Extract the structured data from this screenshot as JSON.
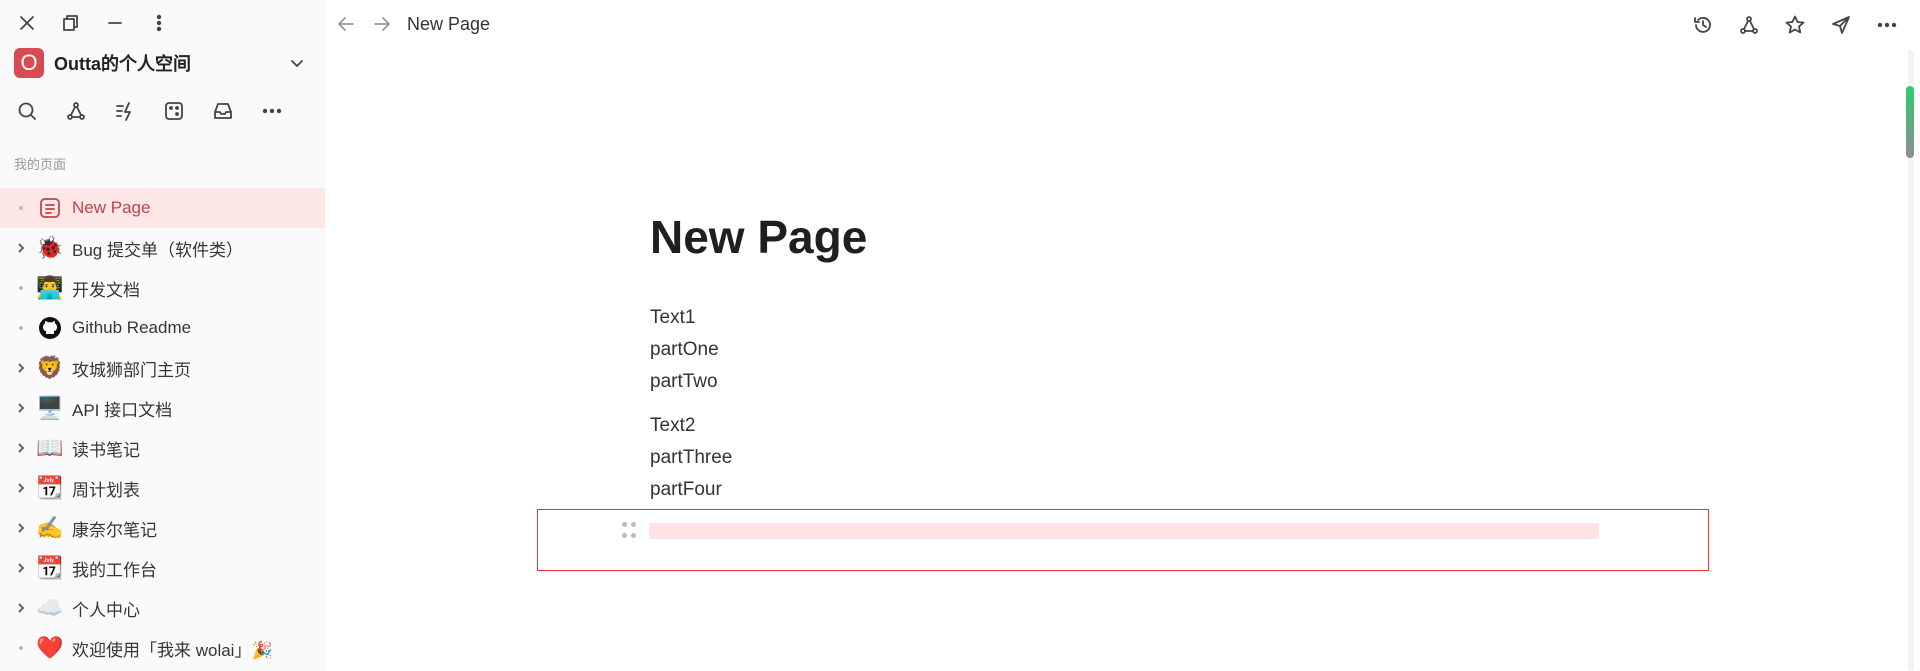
{
  "workspace": {
    "initial": "O",
    "name": "Outta的个人空间",
    "accent": "#d94b52"
  },
  "sidebar": {
    "section_label": "我的页面",
    "items": [
      {
        "label": "New Page",
        "emoji": "📄",
        "toggle": "dot",
        "active": true
      },
      {
        "label": "Bug 提交单（软件类）",
        "emoji": "🐞",
        "toggle": "arrow",
        "active": false
      },
      {
        "label": "开发文档",
        "emoji": "👨‍💻",
        "toggle": "dot",
        "active": false
      },
      {
        "label": "Github Readme",
        "emoji": "github-icon",
        "toggle": "dot",
        "active": false
      },
      {
        "label": "攻城狮部门主页",
        "emoji": "🦁",
        "toggle": "arrow",
        "active": false
      },
      {
        "label": "API 接口文档",
        "emoji": "🖥️",
        "toggle": "arrow",
        "active": false
      },
      {
        "label": "读书笔记",
        "emoji": "📖",
        "toggle": "arrow",
        "active": false
      },
      {
        "label": "周计划表",
        "emoji": "📆",
        "toggle": "arrow",
        "active": false
      },
      {
        "label": "康奈尔笔记",
        "emoji": "✍️",
        "toggle": "arrow",
        "active": false
      },
      {
        "label": "我的工作台",
        "emoji": "📆",
        "toggle": "arrow",
        "active": false
      },
      {
        "label": "个人中心",
        "emoji": "☁️",
        "toggle": "arrow",
        "active": false
      },
      {
        "label": "欢迎使用「我来 wolai」🎉",
        "emoji": "❤️",
        "toggle": "dot",
        "active": false
      }
    ]
  },
  "topbar": {
    "title": "New Page"
  },
  "page": {
    "title": "New Page",
    "group1": [
      "Text1",
      "partOne",
      "partTwo"
    ],
    "group2": [
      "Text2",
      "partThree",
      "partFour"
    ]
  }
}
